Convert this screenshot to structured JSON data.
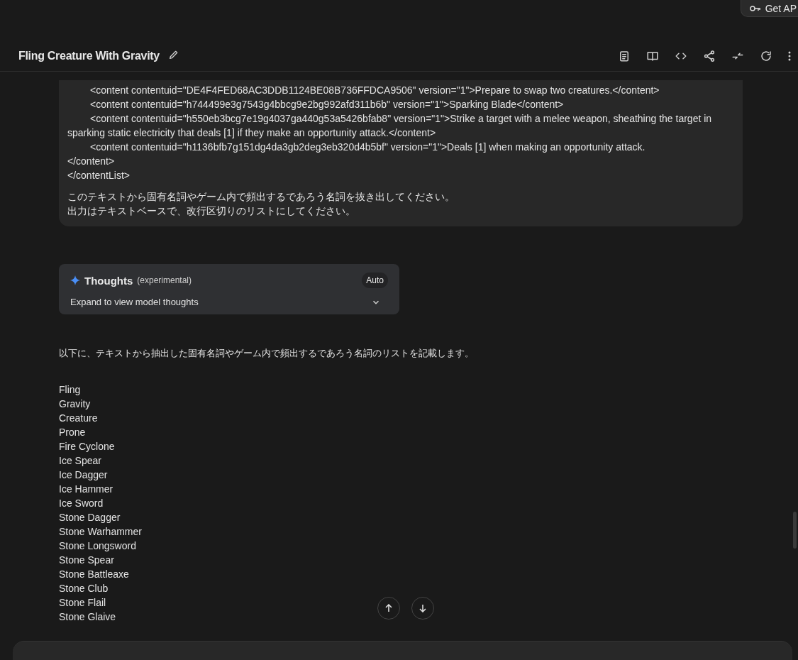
{
  "api_button": {
    "label": "Get AP"
  },
  "header": {
    "title": "Fling Creature With Gravity"
  },
  "user_message": {
    "code_lines": [
      "<content contentuid=\"DE4F4FED68AC3DDB1124BE08B736FFDCA9506\" version=\"1\">Prepare to swap two creatures.</content>",
      "<content contentuid=\"h744499e3g7543g4bbcg9e2bg992afd311b6b\" version=\"1\">Sparking Blade</content>",
      "<content contentuid=\"h550eb3bcg7e19g4037ga440g53a5426bfab8\" version=\"1\">Strike a target with a melee weapon, sheathing the target in sparking static electricity that deals [1] if they make an opportunity attack.</content>",
      "<content contentuid=\"h1136bfb7g151dg4da3gb2deg3eb320d4b5bf\" version=\"1\">Deals [1] when making an opportunity attack.",
      "</content>",
      "</contentList>"
    ],
    "prompt_lines": [
      "このテキストから固有名詞やゲーム内で頻出するであろう名詞を抜き出してください。",
      "出力はテキストベースで、改行区切りのリストにしてください。"
    ]
  },
  "thoughts": {
    "title": "Thoughts",
    "note": "(experimental)",
    "mode": "Auto",
    "expand_label": "Expand to view model thoughts",
    "expanded": false
  },
  "response": {
    "intro": "以下に、テキストから抽出した固有名詞やゲーム内で頻出するであろう名詞のリストを記載します。",
    "items": [
      "Fling",
      "Gravity",
      "Creature",
      "Prone",
      "Fire Cyclone",
      "Ice Spear",
      "Ice Dagger",
      "Ice Hammer",
      "Ice Sword",
      "Stone Dagger",
      "Stone Warhammer",
      "Stone Longsword",
      "Stone Spear",
      "Stone Battleaxe",
      "Stone Club",
      "Stone Flail",
      "Stone Glaive"
    ]
  }
}
